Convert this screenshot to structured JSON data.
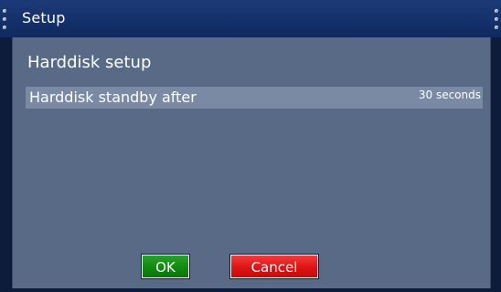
{
  "window": {
    "title": "Setup"
  },
  "dialog": {
    "heading": "Harddisk setup",
    "settings": [
      {
        "label": "Harddisk standby after",
        "value": "30 seconds"
      }
    ]
  },
  "buttons": {
    "ok_label": "OK",
    "cancel_label": "Cancel"
  },
  "colors": {
    "titlebar": "#14306a",
    "panel": "#586a86",
    "selected_row": "#7a8aa4",
    "ok_button": "#118a11",
    "cancel_button": "#de1414"
  }
}
